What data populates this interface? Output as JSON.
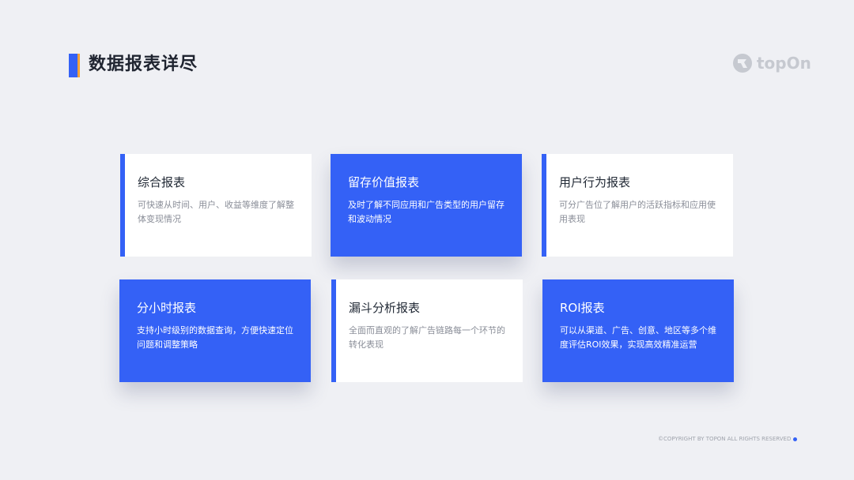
{
  "header": {
    "title": "数据报表详尽",
    "logo_text": "topOn",
    "colors": {
      "accent": "#3461f6",
      "accent_secondary": "#f5a23a"
    }
  },
  "cards": [
    {
      "title": "综合报表",
      "description": "可快速从时间、用户、收益等维度了解整体变现情况",
      "style": "white"
    },
    {
      "title": "留存价值报表",
      "description": "及时了解不同应用和广告类型的用户留存和波动情况",
      "style": "blue"
    },
    {
      "title": "用户行为报表",
      "description": "可分广告位了解用户的活跃指标和应用使用表现",
      "style": "white"
    },
    {
      "title": "分小时报表",
      "description": "支持小时级别的数据查询，方便快速定位问题和调整策略",
      "style": "blue"
    },
    {
      "title": "漏斗分析报表",
      "description": "全面而直观的了解广告链路每一个环节的转化表现",
      "style": "white"
    },
    {
      "title": "ROI报表",
      "description": "可以从渠道、广告、创意、地区等多个维度评估ROI效果，实现高效精准运营",
      "style": "blue"
    }
  ],
  "footer": {
    "copyright": "©COPYRIGHT BY TOPON ALL RIGHTS RESERVED"
  }
}
